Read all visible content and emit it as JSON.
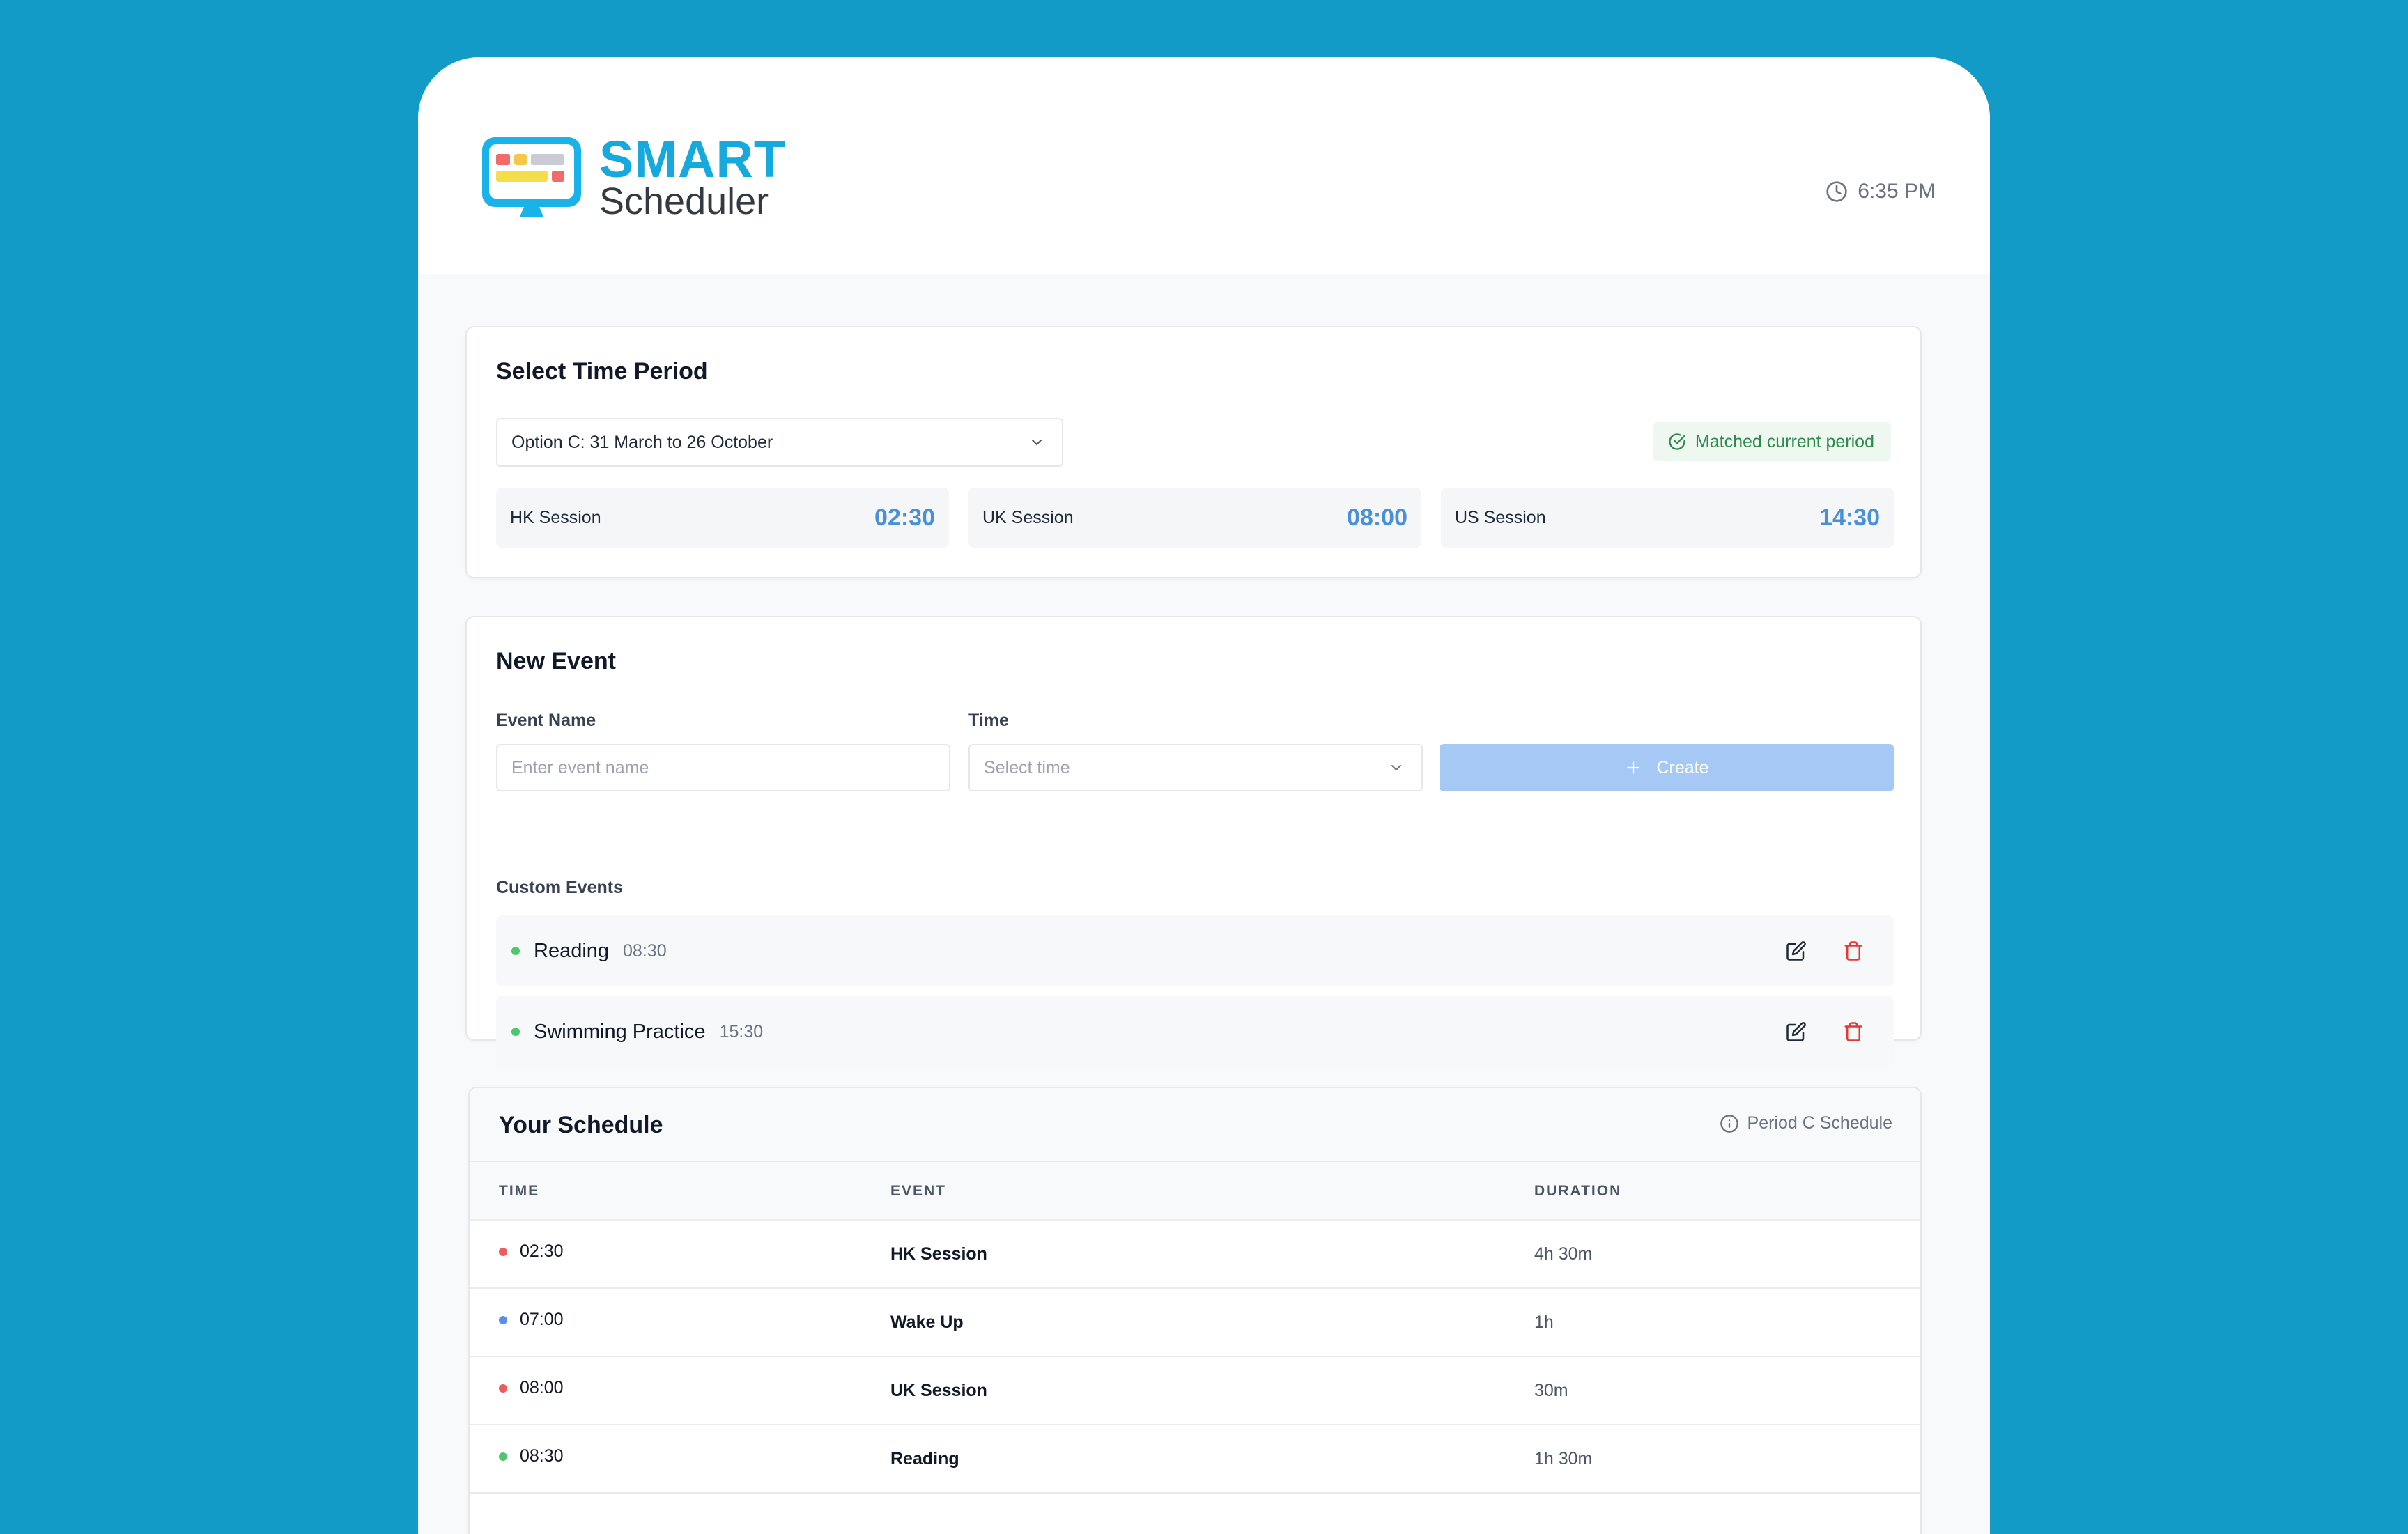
{
  "header": {
    "logo_title": "SMART",
    "logo_subtitle": "Scheduler",
    "clock_time": "6:35 PM"
  },
  "period": {
    "title": "Select Time Period",
    "selected_option": "Option C: 31 March to 26 October",
    "match_badge": "Matched current period",
    "sessions": [
      {
        "name": "HK Session",
        "time": "02:30"
      },
      {
        "name": "UK Session",
        "time": "08:00"
      },
      {
        "name": "US Session",
        "time": "14:30"
      }
    ]
  },
  "new_event": {
    "title": "New Event",
    "name_label": "Event Name",
    "name_placeholder": "Enter event name",
    "time_label": "Time",
    "time_placeholder": "Select time",
    "create_label": "Create",
    "custom_events_label": "Custom Events",
    "custom_events": [
      {
        "name": "Reading",
        "time": "08:30"
      },
      {
        "name": "Swimming Practice",
        "time": "15:30"
      }
    ]
  },
  "schedule": {
    "title": "Your Schedule",
    "period_note": "Period C Schedule",
    "columns": [
      "TIME",
      "EVENT",
      "DURATION"
    ],
    "rows": [
      {
        "time": "02:30",
        "event": "HK Session",
        "duration": "4h 30m",
        "dot_color": "#ef5b5b"
      },
      {
        "time": "07:00",
        "event": "Wake Up",
        "duration": "1h",
        "dot_color": "#5b8def"
      },
      {
        "time": "08:00",
        "event": "UK Session",
        "duration": "30m",
        "dot_color": "#ef5b5b"
      },
      {
        "time": "08:30",
        "event": "Reading",
        "duration": "1h 30m",
        "dot_color": "#4cc76d"
      }
    ]
  },
  "colors": {
    "background": "#139bc7",
    "accent_blue": "#4a90d9",
    "brand_cyan": "#16a9de",
    "success_green": "#2f8a4c",
    "danger_red": "#e53935"
  }
}
